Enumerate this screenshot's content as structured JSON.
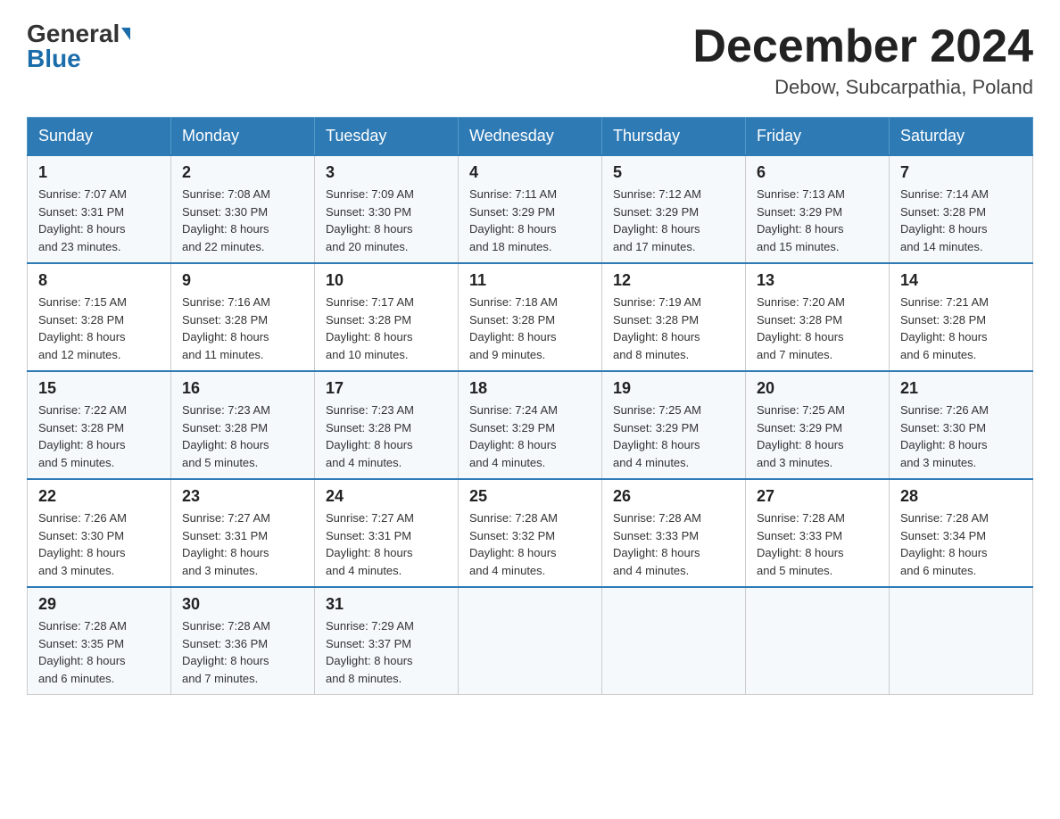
{
  "header": {
    "logo_general": "General",
    "logo_blue": "Blue",
    "month_title": "December 2024",
    "location": "Debow, Subcarpathia, Poland"
  },
  "weekdays": [
    "Sunday",
    "Monday",
    "Tuesday",
    "Wednesday",
    "Thursday",
    "Friday",
    "Saturday"
  ],
  "weeks": [
    [
      {
        "day": "1",
        "sunrise": "7:07 AM",
        "sunset": "3:31 PM",
        "daylight": "8 hours and 23 minutes."
      },
      {
        "day": "2",
        "sunrise": "7:08 AM",
        "sunset": "3:30 PM",
        "daylight": "8 hours and 22 minutes."
      },
      {
        "day": "3",
        "sunrise": "7:09 AM",
        "sunset": "3:30 PM",
        "daylight": "8 hours and 20 minutes."
      },
      {
        "day": "4",
        "sunrise": "7:11 AM",
        "sunset": "3:29 PM",
        "daylight": "8 hours and 18 minutes."
      },
      {
        "day": "5",
        "sunrise": "7:12 AM",
        "sunset": "3:29 PM",
        "daylight": "8 hours and 17 minutes."
      },
      {
        "day": "6",
        "sunrise": "7:13 AM",
        "sunset": "3:29 PM",
        "daylight": "8 hours and 15 minutes."
      },
      {
        "day": "7",
        "sunrise": "7:14 AM",
        "sunset": "3:28 PM",
        "daylight": "8 hours and 14 minutes."
      }
    ],
    [
      {
        "day": "8",
        "sunrise": "7:15 AM",
        "sunset": "3:28 PM",
        "daylight": "8 hours and 12 minutes."
      },
      {
        "day": "9",
        "sunrise": "7:16 AM",
        "sunset": "3:28 PM",
        "daylight": "8 hours and 11 minutes."
      },
      {
        "day": "10",
        "sunrise": "7:17 AM",
        "sunset": "3:28 PM",
        "daylight": "8 hours and 10 minutes."
      },
      {
        "day": "11",
        "sunrise": "7:18 AM",
        "sunset": "3:28 PM",
        "daylight": "8 hours and 9 minutes."
      },
      {
        "day": "12",
        "sunrise": "7:19 AM",
        "sunset": "3:28 PM",
        "daylight": "8 hours and 8 minutes."
      },
      {
        "day": "13",
        "sunrise": "7:20 AM",
        "sunset": "3:28 PM",
        "daylight": "8 hours and 7 minutes."
      },
      {
        "day": "14",
        "sunrise": "7:21 AM",
        "sunset": "3:28 PM",
        "daylight": "8 hours and 6 minutes."
      }
    ],
    [
      {
        "day": "15",
        "sunrise": "7:22 AM",
        "sunset": "3:28 PM",
        "daylight": "8 hours and 5 minutes."
      },
      {
        "day": "16",
        "sunrise": "7:23 AM",
        "sunset": "3:28 PM",
        "daylight": "8 hours and 5 minutes."
      },
      {
        "day": "17",
        "sunrise": "7:23 AM",
        "sunset": "3:28 PM",
        "daylight": "8 hours and 4 minutes."
      },
      {
        "day": "18",
        "sunrise": "7:24 AM",
        "sunset": "3:29 PM",
        "daylight": "8 hours and 4 minutes."
      },
      {
        "day": "19",
        "sunrise": "7:25 AM",
        "sunset": "3:29 PM",
        "daylight": "8 hours and 4 minutes."
      },
      {
        "day": "20",
        "sunrise": "7:25 AM",
        "sunset": "3:29 PM",
        "daylight": "8 hours and 3 minutes."
      },
      {
        "day": "21",
        "sunrise": "7:26 AM",
        "sunset": "3:30 PM",
        "daylight": "8 hours and 3 minutes."
      }
    ],
    [
      {
        "day": "22",
        "sunrise": "7:26 AM",
        "sunset": "3:30 PM",
        "daylight": "8 hours and 3 minutes."
      },
      {
        "day": "23",
        "sunrise": "7:27 AM",
        "sunset": "3:31 PM",
        "daylight": "8 hours and 3 minutes."
      },
      {
        "day": "24",
        "sunrise": "7:27 AM",
        "sunset": "3:31 PM",
        "daylight": "8 hours and 4 minutes."
      },
      {
        "day": "25",
        "sunrise": "7:28 AM",
        "sunset": "3:32 PM",
        "daylight": "8 hours and 4 minutes."
      },
      {
        "day": "26",
        "sunrise": "7:28 AM",
        "sunset": "3:33 PM",
        "daylight": "8 hours and 4 minutes."
      },
      {
        "day": "27",
        "sunrise": "7:28 AM",
        "sunset": "3:33 PM",
        "daylight": "8 hours and 5 minutes."
      },
      {
        "day": "28",
        "sunrise": "7:28 AM",
        "sunset": "3:34 PM",
        "daylight": "8 hours and 6 minutes."
      }
    ],
    [
      {
        "day": "29",
        "sunrise": "7:28 AM",
        "sunset": "3:35 PM",
        "daylight": "8 hours and 6 minutes."
      },
      {
        "day": "30",
        "sunrise": "7:28 AM",
        "sunset": "3:36 PM",
        "daylight": "8 hours and 7 minutes."
      },
      {
        "day": "31",
        "sunrise": "7:29 AM",
        "sunset": "3:37 PM",
        "daylight": "8 hours and 8 minutes."
      },
      null,
      null,
      null,
      null
    ]
  ],
  "labels": {
    "sunrise": "Sunrise:",
    "sunset": "Sunset:",
    "daylight": "Daylight:"
  }
}
